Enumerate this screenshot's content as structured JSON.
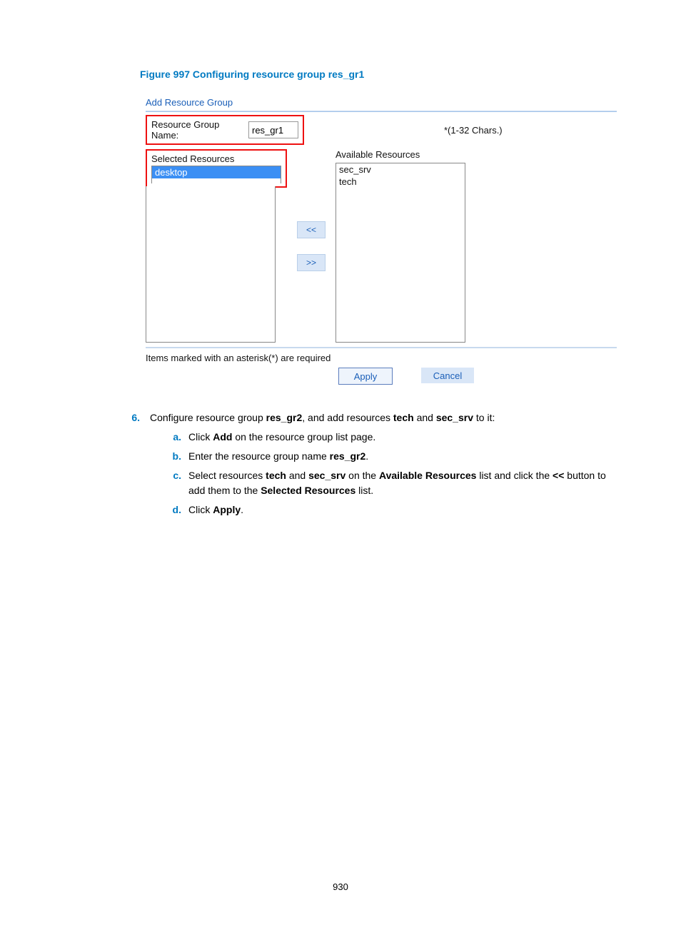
{
  "figure_caption": "Figure 997 Configuring resource group res_gr1",
  "ui": {
    "title": "Add Resource Group",
    "name_label": "Resource Group Name:",
    "name_value": "res_gr1",
    "name_hint": "*(1-32 Chars.)",
    "selected_label": "Selected Resources",
    "available_label": "Available Resources",
    "selected_items": [
      "desktop"
    ],
    "available_items": [
      "sec_srv",
      "tech"
    ],
    "move_left": "<<",
    "move_right": ">>",
    "required_note": "Items marked with an asterisk(*) are required",
    "apply": "Apply",
    "cancel": "Cancel"
  },
  "step6": {
    "num": "6.",
    "text_pre": "Configure resource group ",
    "rg2": "res_gr2",
    "text_mid1": ", and add resources ",
    "tech": "tech",
    "and": " and ",
    "secsrv": "sec_srv",
    "text_post": " to it:",
    "a_num": "a.",
    "a_pre": "Click ",
    "a_bold": "Add",
    "a_post": " on the resource group list page.",
    "b_num": "b.",
    "b_pre": "Enter the resource group name ",
    "b_bold": "res_gr2",
    "b_post": ".",
    "c_num": "c.",
    "c_pre": "Select resources ",
    "c_tech": "tech",
    "c_and": " and ",
    "c_sec": "sec_srv",
    "c_mid": " on the ",
    "c_avail": "Available Resources",
    "c_mid2": " list and click the ",
    "c_btn": "<<",
    "c_mid3": " button to add them to the ",
    "c_sel": "Selected Resources",
    "c_post": " list.",
    "d_num": "d.",
    "d_pre": "Click ",
    "d_bold": "Apply",
    "d_post": "."
  },
  "page_number": "930"
}
